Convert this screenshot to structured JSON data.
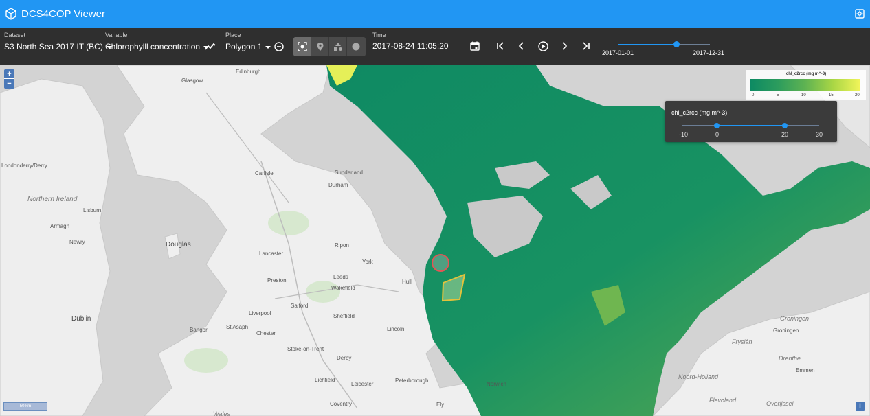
{
  "app": {
    "title": "DCS4COP Viewer"
  },
  "toolbar": {
    "dataset": {
      "label": "Dataset",
      "value": "S3 North Sea 2017 IT (BC)"
    },
    "variable": {
      "label": "Variable",
      "value": "Chlorophylll concentration"
    },
    "place": {
      "label": "Place",
      "value": "Polygon 1"
    },
    "time": {
      "label": "Time",
      "value": "2017-08-24 11:05:20"
    },
    "time_slider": {
      "start_label": "2017-01-01",
      "end_label": "2017-12-31",
      "position_fraction": 0.64
    }
  },
  "legend": {
    "title": "chl_c2rcc (mg m^-3)",
    "ticks": [
      "0",
      "5",
      "10",
      "15",
      "20"
    ]
  },
  "color_range_popup": {
    "title": "chl_c2rcc (mg m^-3)",
    "scale_labels": [
      "-10",
      "0",
      "20",
      "30"
    ],
    "low_value": 0,
    "high_value": 20,
    "min": -10,
    "max": 30
  },
  "map": {
    "zoom_in_label": "+",
    "zoom_out_label": "−",
    "scale_label": "50 km",
    "info_label": "i",
    "places": {
      "edinburgh": "Edinburgh",
      "glasgow": "Glasgow",
      "londonderry": "Londonderry/Derry",
      "northern_ireland": "Northern Ireland",
      "lisburn": "Lisburn",
      "armagh": "Armagh",
      "newry": "Newry",
      "douglas": "Douglas",
      "dublin": "Dublin",
      "carlisle": "Carlisle",
      "sunderland": "Sunderland",
      "durham": "Durham",
      "lancaster": "Lancaster",
      "ripon": "Ripon",
      "york": "York",
      "preston": "Preston",
      "leeds": "Leeds",
      "wakefield": "Wakefield",
      "hull": "Hull",
      "salford": "Salford",
      "liverpool": "Liverpool",
      "sheffield": "Sheffield",
      "bangor": "Bangor",
      "st_asaph": "St Asaph",
      "chester": "Chester",
      "lincoln": "Lincoln",
      "stoke": "Stoke-on-Trent",
      "derby": "Derby",
      "lichfield": "Lichfield",
      "leicester": "Leicester",
      "peterborough": "Peterborough",
      "norwich": "Norwich",
      "coventry": "Coventry",
      "ely": "Ely",
      "wales": "Wales",
      "groningen_prov": "Groningen",
      "groningen": "Groningen",
      "fryslan": "Fryslân",
      "drenthe": "Drenthe",
      "emmen": "Emmen",
      "noord_holland": "Noord-Holland",
      "flevoland": "Flevoland",
      "overijssel": "Overijssel"
    }
  }
}
